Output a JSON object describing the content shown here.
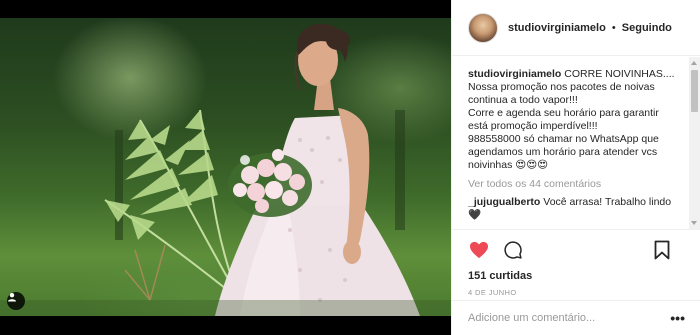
{
  "post": {
    "username": "studiovirginiamelo",
    "separator": "•",
    "follow_status": "Seguindo",
    "caption_username": "studiovirginiamelo",
    "caption_lines": [
      "CORRE NOIVINHAS....",
      "Nossa promoção nos pacotes de noivas",
      "continua a todo vapor!!!",
      "Corre e agenda seu horário para garantir",
      "está promoção imperdível!!!",
      "988558000 só chamar no WhatsApp que",
      "agendamos um horário para atender vcs",
      "noivinhas 😍😍😍"
    ],
    "view_all_comments": "Ver todos os 44 comentários",
    "comments": [
      {
        "username": "_jujugualberto",
        "text": "Você arrasa! Trabalho lindo",
        "emoji": "🖤"
      }
    ],
    "likes": "151 curtidas",
    "date": "4 de junho",
    "comment_placeholder": "Adicione um comentário...",
    "more_label": "•••"
  },
  "colors": {
    "like_heart": "#ed4956",
    "text": "#262626",
    "secondary": "#999999",
    "border": "#efefef"
  },
  "icons": {
    "like": "heart-icon",
    "comment": "comment-bubble-icon",
    "save": "bookmark-icon",
    "user_tag": "user-tag-icon"
  }
}
